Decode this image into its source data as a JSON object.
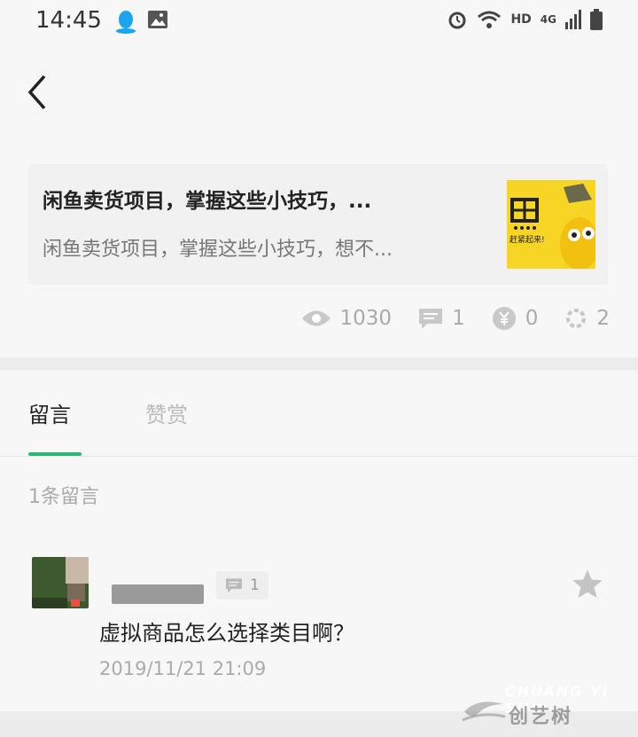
{
  "status_bar": {
    "time": "14:45",
    "network_label": "HD",
    "network_gen": "4G"
  },
  "article": {
    "title": "闲鱼卖货项目，掌握这些小技巧，...",
    "summary": "闲鱼卖货项目，掌握这些小技巧，想不...",
    "thumb_text": "赶紧起来!"
  },
  "stats": {
    "views": "1030",
    "comments": "1",
    "rewards": "0",
    "likes": "2"
  },
  "tabs": [
    {
      "label": "留言",
      "active": true
    },
    {
      "label": "赞赏",
      "active": false
    }
  ],
  "comments_count": "1条留言",
  "comment": {
    "replies": "1",
    "text": "虚拟商品怎么选择类目啊？",
    "time": "2019/11/21 21:09"
  },
  "watermark": {
    "top": "CHUANG YI SHU",
    "bottom": "创艺树"
  },
  "colors": {
    "accent": "#2bb673",
    "thumb_bg": "#f7d524",
    "background": "#f7f7f7"
  }
}
